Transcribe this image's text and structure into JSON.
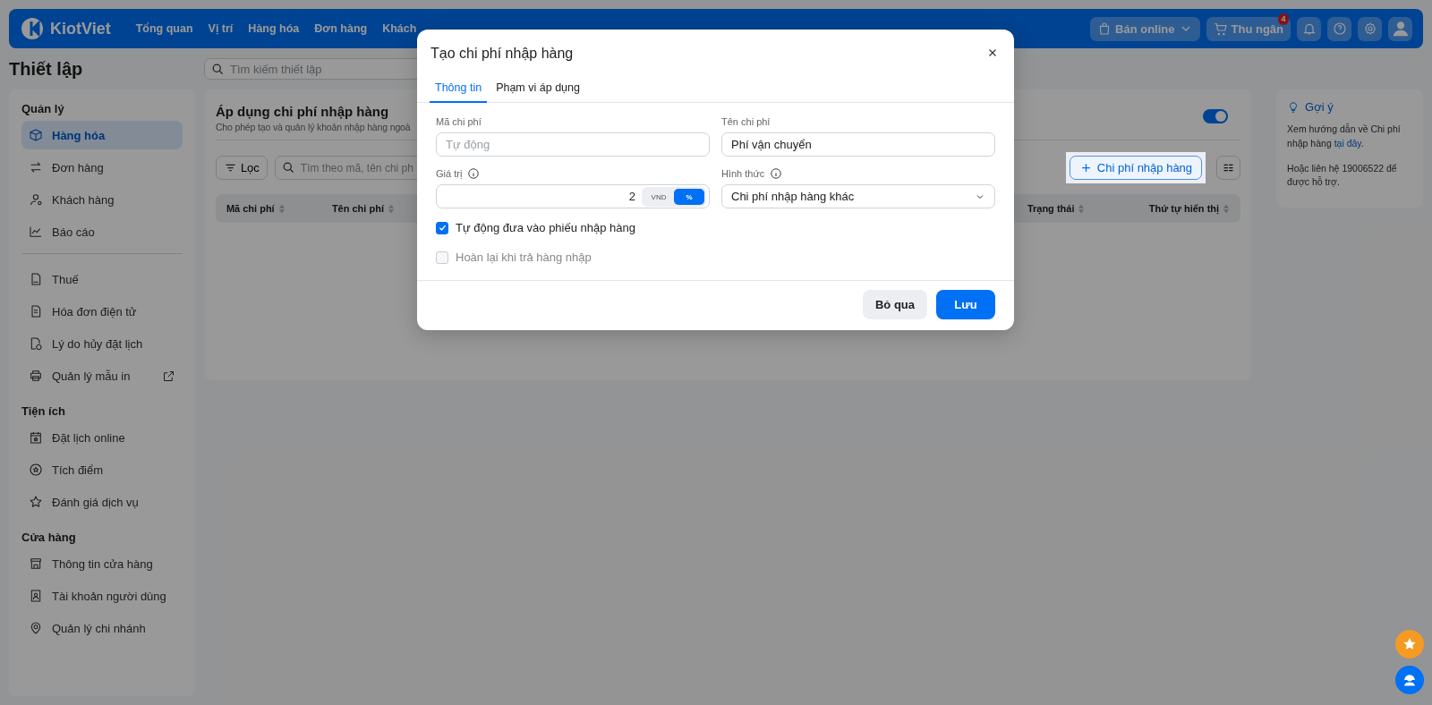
{
  "topbar": {
    "brand": "KiotViet",
    "nav": [
      "Tổng quan",
      "Vị trí",
      "Hàng hóa",
      "Đơn hàng",
      "Khách"
    ],
    "online_button": "Bán online",
    "cashier_button": "Thu ngân",
    "notification_count": "4"
  },
  "page_title": "Thiết lập",
  "settings_search": {
    "placeholder": "Tìm kiếm thiết lập"
  },
  "sidebar": {
    "sections": [
      {
        "title": "Quản lý",
        "groups": [
          [
            {
              "label": "Hàng hóa",
              "selected": true,
              "external": false
            },
            {
              "label": "Đơn hàng",
              "selected": false,
              "external": false
            },
            {
              "label": "Khách hàng",
              "selected": false,
              "external": false
            },
            {
              "label": "Báo cáo",
              "selected": false,
              "external": false
            }
          ],
          [
            {
              "label": "Thuế",
              "selected": false,
              "external": false
            },
            {
              "label": "Hóa đơn điện tử",
              "selected": false,
              "external": false
            },
            {
              "label": "Lý do hủy đặt lịch",
              "selected": false,
              "external": false
            },
            {
              "label": "Quản lý mẫu in",
              "selected": false,
              "external": true
            }
          ]
        ]
      },
      {
        "title": "Tiện ích",
        "groups": [
          [
            {
              "label": "Đặt lịch online",
              "selected": false,
              "external": false
            },
            {
              "label": "Tích điểm",
              "selected": false,
              "external": false
            },
            {
              "label": "Đánh giá dịch vụ",
              "selected": false,
              "external": false
            }
          ]
        ]
      },
      {
        "title": "Cửa hàng",
        "groups": [
          [
            {
              "label": "Thông tin cửa hàng",
              "selected": false,
              "external": false
            },
            {
              "label": "Tài khoản người dùng",
              "selected": false,
              "external": false
            },
            {
              "label": "Quản lý chi nhánh",
              "selected": false,
              "external": false
            }
          ]
        ]
      }
    ]
  },
  "main": {
    "title": "Áp dụng chi phí nhập hàng",
    "description": "Cho phép tạo và quản lý khoản nhập hàng ngoà",
    "enabled": true,
    "filter_button": "Lọc",
    "search": {
      "placeholder": "Tìm theo mã, tên chi ph"
    },
    "add_button": "Chi phí nhập hàng",
    "table": {
      "columns": [
        "Mã chi phí",
        "Tên chi phí",
        "Trạng thái",
        "Thứ tự hiển thị"
      ]
    }
  },
  "hint": {
    "title": "Gợi ý",
    "text": "Xem hướng dẫn về Chi phí nhập hàng",
    "link": "tại đây",
    "text_end": ".",
    "contact": "Hoặc liên hệ 19006522 để được hỗ trợ."
  },
  "dialog": {
    "title": "Tạo chi phí nhập hàng",
    "tabs": [
      {
        "label": "Thông tin",
        "selected": true
      },
      {
        "label": "Phạm vi áp dụng",
        "selected": false
      }
    ],
    "code": {
      "label": "Mã chi phí",
      "placeholder": "Tự động"
    },
    "name": {
      "label": "Tên chi phí",
      "value": "Phí vận chuyển"
    },
    "value": {
      "label": "Giá trị",
      "value": "2",
      "units": [
        {
          "label": "VND",
          "selected": false
        },
        {
          "label": "%",
          "selected": true
        }
      ]
    },
    "form": {
      "label": "Hình thức",
      "value": "Chi phí nhập hàng khác"
    },
    "checkboxes": [
      {
        "label": "Tự động đưa vào phiếu nhập hàng",
        "checked": true,
        "disabled": false
      },
      {
        "label": "Hoàn lại khi trả hàng nhập",
        "checked": false,
        "disabled": true
      }
    ],
    "buttons": [
      {
        "label": "Bỏ qua",
        "kind": "secondary"
      },
      {
        "label": "Lưu",
        "kind": "primary"
      }
    ]
  }
}
